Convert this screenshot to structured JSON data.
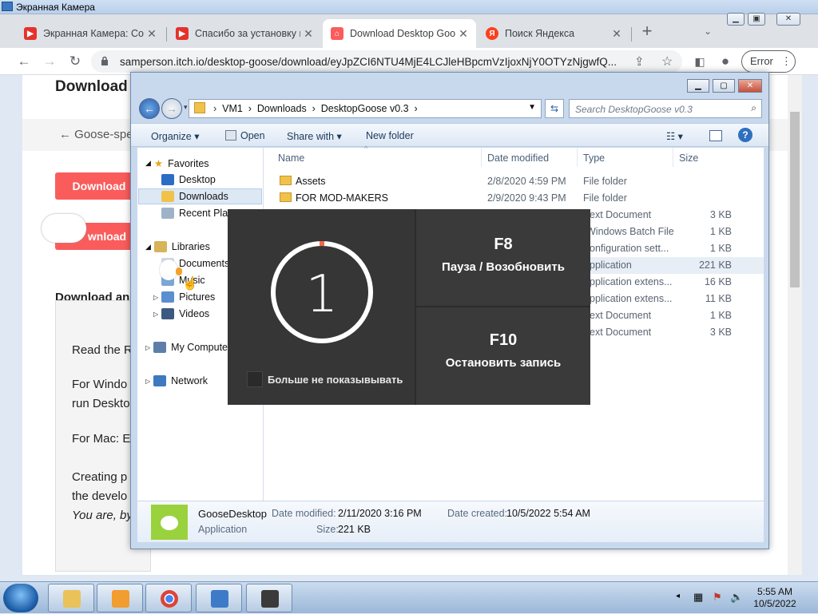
{
  "os_window": {
    "title": "Экранная Камера"
  },
  "browser": {
    "tabs": [
      {
        "label": "Экранная Камера: Софт",
        "favicon": "youtube-icon",
        "active": false
      },
      {
        "label": "Спасибо за установку п",
        "favicon": "youtube-icon",
        "active": false
      },
      {
        "label": "Download Desktop Goose",
        "favicon": "itchio-icon",
        "active": true
      },
      {
        "label": "Поиск Яндекса",
        "favicon": "yandex-icon",
        "active": false
      }
    ],
    "new_tab_glyph": "+",
    "url": "samperson.itch.io/desktop-goose/download/eyJpZCI6NTU4MjE4LCJleHBpcmVzIjoxNjY0OTYzNjgwfQ...",
    "error_button": "Error"
  },
  "webpage": {
    "title": "Download",
    "back_link": "← Goose-spe",
    "download_button_1": "Download",
    "download_button_2": "wnload",
    "section_heading": "Download an",
    "paragraphs": [
      "Read the R",
      "For Windo",
      "run Deskto",
      "For Mac: E",
      "Creating p",
      "the develo",
      "You are, by"
    ]
  },
  "explorer": {
    "breadcrumbs": [
      "VM1",
      "Downloads",
      "DesktopGoose v0.3"
    ],
    "search_placeholder": "Search DesktopGoose v0.3",
    "commands": {
      "organize": "Organize ▾",
      "open": "Open",
      "share_with": "Share with ▾",
      "new_folder": "New folder"
    },
    "nav": {
      "favorites": "Favorites",
      "desktop": "Desktop",
      "downloads": "Downloads",
      "recent": "Recent Places",
      "libraries": "Libraries",
      "documents": "Documents",
      "music": "Music",
      "pictures": "Pictures",
      "videos": "Videos",
      "computer": "My Computer",
      "network": "Network"
    },
    "columns": {
      "name": "Name",
      "date": "Date modified",
      "type": "Type",
      "size": "Size"
    },
    "files": [
      {
        "name": "Assets",
        "date": "2/8/2020 4:59 PM",
        "type": "File folder",
        "size": ""
      },
      {
        "name": "FOR MOD-MAKERS",
        "date": "2/9/2020 9:43 PM",
        "type": "File folder",
        "size": ""
      },
      {
        "name": "",
        "date": "",
        "type": "ext Document",
        "size": "3 KB"
      },
      {
        "name": "",
        "date": "",
        "type": "Windows Batch File",
        "size": "1 KB"
      },
      {
        "name": "",
        "date": "",
        "type": "onfiguration sett...",
        "size": "1 KB"
      },
      {
        "name": "",
        "date": "",
        "type": "pplication",
        "size": "221 KB"
      },
      {
        "name": "",
        "date": "",
        "type": "pplication extens...",
        "size": "16 KB"
      },
      {
        "name": "",
        "date": "",
        "type": "pplication extens...",
        "size": "11 KB"
      },
      {
        "name": "",
        "date": "",
        "type": "ext Document",
        "size": "1 KB"
      },
      {
        "name": "",
        "date": "",
        "type": "ext Document",
        "size": "3 KB"
      }
    ],
    "details": {
      "name": "GooseDesktop",
      "kind": "Application",
      "date_modified_label": "Date modified:",
      "date_modified": "2/11/2020 3:16 PM",
      "size_label": "Size:",
      "size": "221 KB",
      "date_created_label": "Date created:",
      "date_created": "10/5/2022 5:54 AM"
    }
  },
  "recorder_overlay": {
    "countdown": "1",
    "dont_show_label": "Больше не показывывать",
    "hotkeys": [
      {
        "key": "F8",
        "action": "Пауза / Возобновить"
      },
      {
        "key": "F10",
        "action": "Остановить запись"
      }
    ]
  },
  "taskbar": {
    "clock_time": "5:55 AM",
    "clock_date": "10/5/2022"
  },
  "colors": {
    "accent_download": "#fa5c5c",
    "overlay_bg": "#3a3a3a",
    "countdown_tick": "#f06a4a"
  }
}
